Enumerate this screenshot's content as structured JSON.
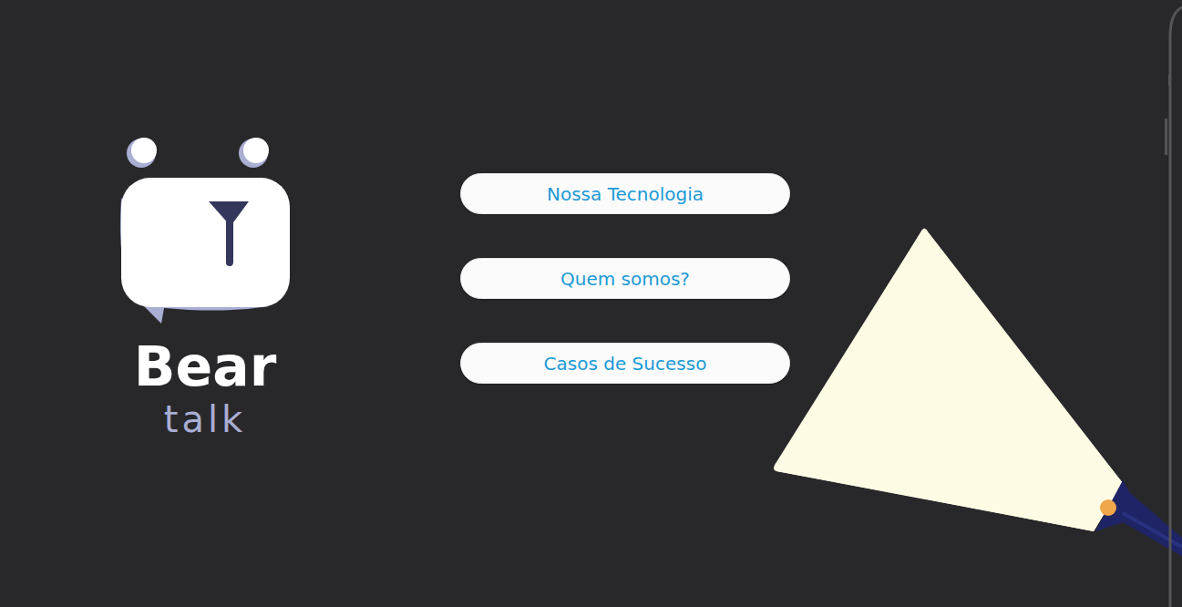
{
  "logo": {
    "title": "Bear",
    "subtitle": "talk"
  },
  "menu": [
    {
      "label": "Nossa Tecnologia"
    },
    {
      "label": "Quem somos?"
    },
    {
      "label": "Casos de Sucesso"
    }
  ]
}
